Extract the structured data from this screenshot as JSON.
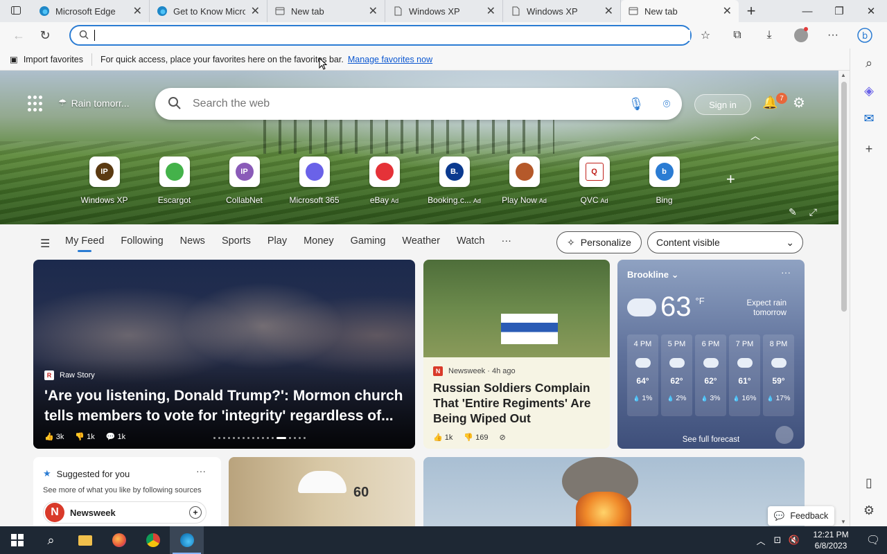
{
  "tabs": [
    {
      "title": "Microsoft Edge",
      "icon": "edge-icon"
    },
    {
      "title": "Get to Know Microsoft Edge",
      "icon": "edge-icon"
    },
    {
      "title": "New tab",
      "icon": "page-icon"
    },
    {
      "title": "Windows XP",
      "icon": "page-icon"
    },
    {
      "title": "Windows XP",
      "icon": "page-icon"
    },
    {
      "title": "New tab",
      "icon": "newtab-icon",
      "active": true
    }
  ],
  "address": {
    "value": "",
    "placeholder": ""
  },
  "favorites_bar": {
    "import_label": "Import favorites",
    "hint": "For quick access, place your favorites here on the favorites bar.",
    "manage_link": "Manage favorites now"
  },
  "hero": {
    "weather_text": "Rain tomorr...",
    "search_placeholder": "Search the web",
    "signin_label": "Sign in",
    "notification_count": "7"
  },
  "quick_links": [
    {
      "label": "Windows XP",
      "ad": "",
      "logo_text": "IP",
      "color": "#5b3a12"
    },
    {
      "label": "Escargot",
      "ad": "",
      "logo_text": "",
      "color": "#44b24a"
    },
    {
      "label": "CollabNet",
      "ad": "",
      "logo_text": "IP",
      "color": "#8a5bb8"
    },
    {
      "label": "Microsoft 365",
      "ad": "",
      "logo_text": "",
      "color": "#6a62e8"
    },
    {
      "label": "eBay",
      "ad": "Ad",
      "logo_text": "",
      "color": "#e53238"
    },
    {
      "label": "Booking.c...",
      "ad": "Ad",
      "logo_text": "B.",
      "color": "#0b3a8f"
    },
    {
      "label": "Play Now",
      "ad": "Ad",
      "logo_text": "",
      "color": "#b5592a"
    },
    {
      "label": "QVC",
      "ad": "Ad",
      "logo_text": "Q",
      "color": "#ffffff"
    },
    {
      "label": "Bing",
      "ad": "",
      "logo_text": "b",
      "color": "#2b7cd3"
    }
  ],
  "feed_tabs": [
    "My Feed",
    "Following",
    "News",
    "Sports",
    "Play",
    "Money",
    "Gaming",
    "Weather",
    "Watch"
  ],
  "feed_more": "···",
  "personalize_label": "Personalize",
  "content_visible_label": "Content visible",
  "main_story": {
    "source": "Raw Story",
    "headline": "'Are you listening, Donald Trump?': Mormon church tells members to vote for 'integrity' regardless of...",
    "likes": "3k",
    "dislikes": "1k",
    "comments": "1k"
  },
  "news_story": {
    "source": "Newsweek · 4h ago",
    "headline": "Russian Soldiers Complain That 'Entire Regiments' Are Being Wiped Out",
    "likes": "1k",
    "dislikes": "169"
  },
  "weather": {
    "location": "Brookline",
    "temp": "63",
    "unit": "°F",
    "forecast_line1": "Expect rain",
    "forecast_line2": "tomorrow",
    "hours": [
      {
        "time": "4 PM",
        "temp": "64°",
        "precip": "1%"
      },
      {
        "time": "5 PM",
        "temp": "62°",
        "precip": "2%"
      },
      {
        "time": "6 PM",
        "temp": "62°",
        "precip": "3%"
      },
      {
        "time": "7 PM",
        "temp": "61°",
        "precip": "16%"
      },
      {
        "time": "8 PM",
        "temp": "59°",
        "precip": "17%"
      }
    ],
    "see_full": "See full forecast"
  },
  "suggested": {
    "title": "Suggested for you",
    "subtitle": "See more of what you like by following sources",
    "source_name": "Newsweek",
    "source_logo": "N"
  },
  "box_card_number": "60",
  "feedback_label": "Feedback",
  "taskbar": {
    "time": "12:21 PM",
    "date": "6/8/2023"
  }
}
